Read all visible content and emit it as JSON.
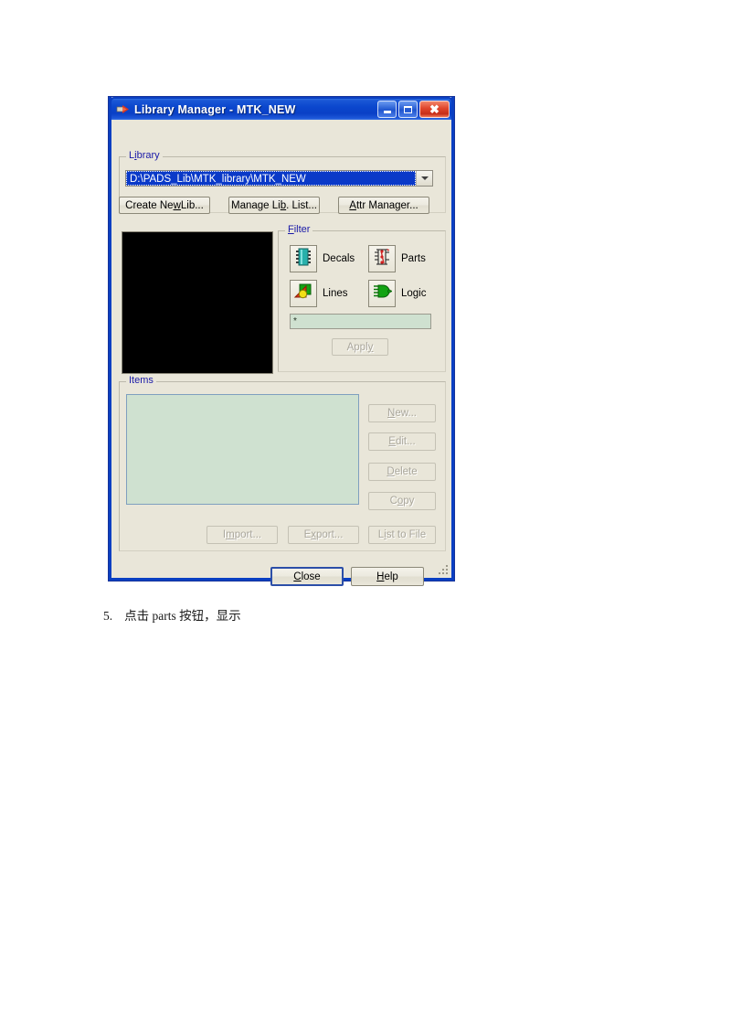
{
  "document": {
    "caption_number": "5.",
    "caption_text": "点击 parts 按钮，显示"
  },
  "window": {
    "title": "Library Manager - MTK_NEW",
    "icon": "library-manager-icon",
    "titlebar_color": "#0a40c6",
    "background_color": "#e9e6d9",
    "controls": {
      "minimize": "minimize-button",
      "maximize": "maximize-button",
      "close": "close-button"
    }
  },
  "library": {
    "legend": "Library",
    "legend_accel": "i",
    "combo_value": "D:\\PADS_Lib\\MTK_library\\MTK_NEW",
    "combo_selected": true,
    "buttons": [
      {
        "label_pre": "Create Ne",
        "accel": "w",
        "label_post": " Lib...",
        "disabled": false
      },
      {
        "label_pre": "Manage Li",
        "accel": "b",
        "label_post": ". List...",
        "disabled": false
      },
      {
        "label_pre": "",
        "accel": "A",
        "label_post": "ttr Manager...",
        "disabled": false
      }
    ]
  },
  "preview": {
    "name": "preview-pane",
    "background": "#000000"
  },
  "filter": {
    "legend": "Filter",
    "legend_accel": "F",
    "items": [
      {
        "label": "Decals",
        "icon": "decal-chip-icon"
      },
      {
        "label": "Parts",
        "icon": "part-schematic-icon"
      },
      {
        "label": "Lines",
        "icon": "lines-shapes-icon"
      },
      {
        "label": "Logic",
        "icon": "logic-gate-icon"
      }
    ],
    "input_value": "*",
    "input_background": "#cfe1d0",
    "apply_pre": "Appl",
    "apply_accel": "y",
    "apply_post": "",
    "apply_disabled": true
  },
  "items": {
    "legend": "Items",
    "list_background": "#cfe1d0",
    "list_entries": [],
    "buttons": [
      {
        "name": "new-button",
        "pre": "",
        "accel": "N",
        "post": "ew...",
        "disabled": true
      },
      {
        "name": "edit-button",
        "pre": "",
        "accel": "E",
        "post": "dit...",
        "disabled": true
      },
      {
        "name": "delete-button",
        "pre": "",
        "accel": "D",
        "post": "elete",
        "disabled": true
      },
      {
        "name": "copy-button",
        "pre": "C",
        "accel": "o",
        "post": "py",
        "disabled": true
      },
      {
        "name": "import-button",
        "pre": "I",
        "accel": "m",
        "post": "port...",
        "disabled": true
      },
      {
        "name": "export-button",
        "pre": "E",
        "accel": "x",
        "post": "port...",
        "disabled": true
      },
      {
        "name": "list-to-file-button",
        "pre": "L",
        "accel": "i",
        "post": "st to File",
        "disabled": true
      }
    ]
  },
  "footer": {
    "close_pre": "",
    "close_accel": "C",
    "close_post": "lose",
    "close_default": true,
    "help_pre": "",
    "help_accel": "H",
    "help_post": "elp"
  }
}
